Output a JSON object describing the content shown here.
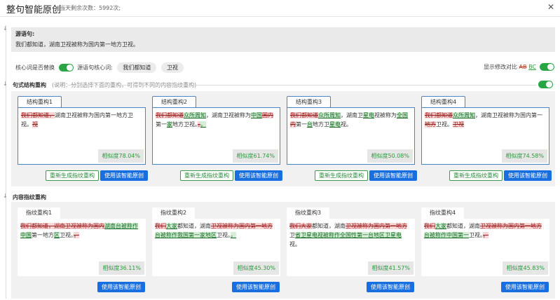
{
  "header": {
    "title": "整句智能原创",
    "remaining": "当天剩余次数：5992次;",
    "close": "✕"
  },
  "source": {
    "label": "源语句:",
    "text": "我们都知道，湖南卫视被称为国内第一地方卫视。"
  },
  "options": {
    "core_replace_label": "核心词是否替换",
    "core_words_label": "源语句核心词:",
    "core_words": [
      "我们都知道",
      "卫视"
    ],
    "diff_label": "显示修改对比",
    "diff_ab": "AB",
    "diff_bc": "BC"
  },
  "structure": {
    "title": "句式结构重构",
    "hint": "(说明：分别选择下面的重构，可得到不同的内容指纹重构)",
    "regen_label": "重新生成指纹重构",
    "use_label": "使用该智能原创",
    "cards": [
      {
        "tab": "结构重构1",
        "similarity": "相似度78.04%",
        "segments": [
          {
            "t": "我们都知道，",
            "k": "d"
          },
          {
            "t": "湖南卫视被称为国内第一地方卫视。",
            "k": "n"
          },
          {
            "t": "视",
            "k": "d"
          }
        ]
      },
      {
        "tab": "结构重构2",
        "similarity": "相似度61.74%",
        "segments": [
          {
            "t": "我们都知道",
            "k": "d"
          },
          {
            "t": "众所周知",
            "k": "i"
          },
          {
            "t": "，湖南卫视被称为",
            "k": "n"
          },
          {
            "t": "中国",
            "k": "i"
          },
          {
            "t": "国内",
            "k": "d"
          },
          {
            "t": "第一",
            "k": "n"
          },
          {
            "t": "家",
            "k": "i"
          },
          {
            "t": "地方卫视。",
            "k": "n"
          },
          {
            "t": "。",
            "k": "d"
          },
          {
            "t": "。",
            "k": "i"
          }
        ]
      },
      {
        "tab": "结构重构3",
        "similarity": "相似度50.08%",
        "segments": [
          {
            "t": "我们都知道",
            "k": "d"
          },
          {
            "t": "众所周知",
            "k": "i"
          },
          {
            "t": "，湖南卫",
            "k": "n"
          },
          {
            "t": "星",
            "k": "i"
          },
          {
            "t": "电",
            "k": "i"
          },
          {
            "t": "视被称为",
            "k": "n"
          },
          {
            "t": "全国",
            "k": "i"
          },
          {
            "t": "内",
            "k": "d"
          },
          {
            "t": "第一",
            "k": "n"
          },
          {
            "t": "台",
            "k": "i"
          },
          {
            "t": "地方卫",
            "k": "n"
          },
          {
            "t": "星电",
            "k": "i"
          },
          {
            "t": "视。",
            "k": "n"
          }
        ]
      },
      {
        "tab": "结构重构4",
        "similarity": "相似度74.58%",
        "segments": [
          {
            "t": "我们都知道",
            "k": "d"
          },
          {
            "t": "众所周知",
            "k": "i"
          },
          {
            "t": "，湖南卫视被称为国内第一",
            "k": "n"
          },
          {
            "t": "地方",
            "k": "d"
          },
          {
            "t": "卫视。",
            "k": "n"
          },
          {
            "t": "卫视",
            "k": "d"
          }
        ]
      }
    ]
  },
  "content": {
    "title": "内容指纹重构",
    "use_label": "使用该智能原创",
    "cards": [
      {
        "tab": "指纹重构1",
        "similarity": "相似度36.11%",
        "segments": [
          {
            "t": "我们都知道，湖南卫视被称为国内",
            "k": "d"
          },
          {
            "t": "湖南台被称作中国",
            "k": "i"
          },
          {
            "t": "第一地方",
            "k": "n"
          },
          {
            "t": "区",
            "k": "i"
          },
          {
            "t": "卫视。",
            "k": "n"
          },
          {
            "t": "。",
            "k": "d"
          }
        ]
      },
      {
        "tab": "指纹重构2",
        "similarity": "相似度45.30%",
        "segments": [
          {
            "t": "我们",
            "k": "d"
          },
          {
            "t": "大家",
            "k": "i"
          },
          {
            "t": "都知道，湖南",
            "k": "n"
          },
          {
            "t": "卫视被称为国内第一地方",
            "k": "d"
          },
          {
            "t": "台被称作我国第一家地区",
            "k": "i"
          },
          {
            "t": "卫视。",
            "k": "n"
          },
          {
            "t": "。",
            "k": "i"
          }
        ]
      },
      {
        "tab": "指纹重构3",
        "similarity": "相似度41.57%",
        "segments": [
          {
            "t": "我们大家",
            "k": "d"
          },
          {
            "t": "都知道，湖南",
            "k": "n"
          },
          {
            "t": "卫视被称为国内第一地方",
            "k": "d"
          },
          {
            "t": "卫",
            "k": "n"
          },
          {
            "t": "省卫星电视被称作全国性第一台地区卫星电",
            "k": "i"
          },
          {
            "t": "视。",
            "k": "n"
          }
        ]
      },
      {
        "tab": "指纹重构4",
        "similarity": "相似度45.83%",
        "segments": [
          {
            "t": "我们",
            "k": "d"
          },
          {
            "t": "大家",
            "k": "i"
          },
          {
            "t": "都知道，湖南",
            "k": "n"
          },
          {
            "t": "卫视被称为国内第一地方",
            "k": "d"
          },
          {
            "t": "台被称作中国第一",
            "k": "i"
          },
          {
            "t": "卫视。",
            "k": "n"
          },
          {
            "t": "。",
            "k": "d"
          }
        ]
      }
    ]
  }
}
